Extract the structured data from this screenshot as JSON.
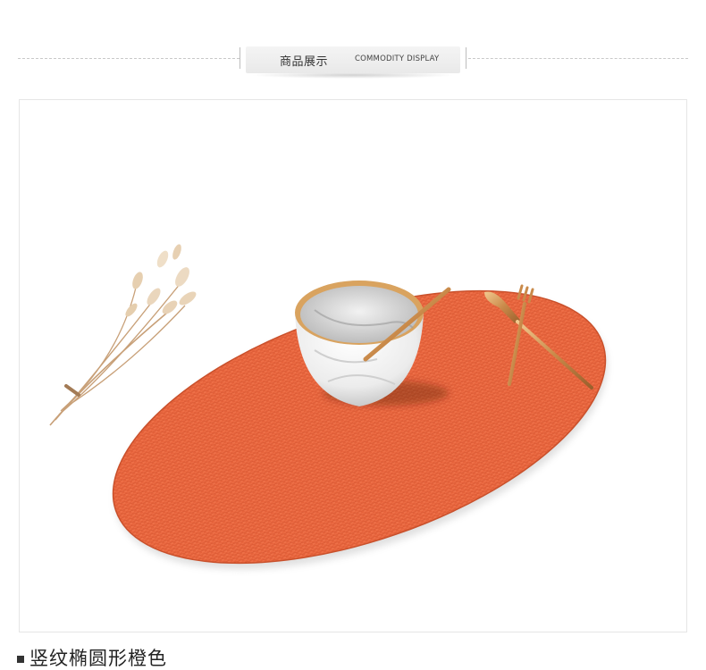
{
  "header": {
    "title_cn": "商品展示",
    "title_en": "COMMODITY DISPLAY"
  },
  "product": {
    "caption": "竖纹椭圆形橙色",
    "mat_color": "#e8643a",
    "mat_color_dark": "#d2522b",
    "accent_gold": "#c98a4a"
  }
}
